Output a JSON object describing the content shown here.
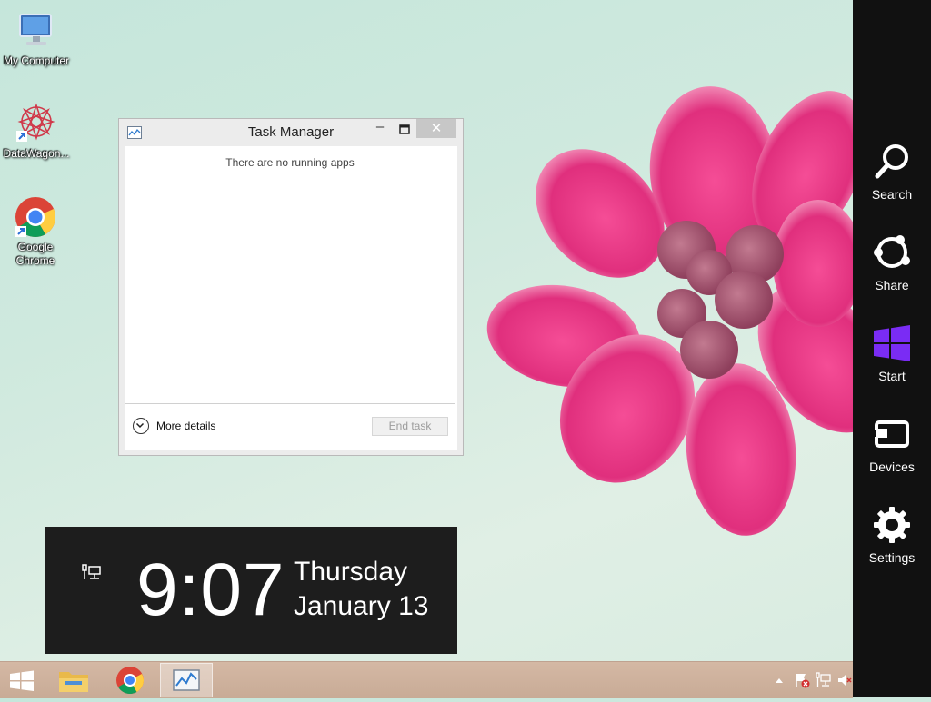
{
  "desktop": {
    "icons": [
      {
        "label": "My Computer"
      },
      {
        "label": "DataWagon..."
      },
      {
        "label": "Google Chrome"
      }
    ]
  },
  "task_manager": {
    "title": "Task Manager",
    "minimize_glyph": "–",
    "close_glyph": "✕",
    "empty_message": "There are no running apps",
    "more_details_label": "More details",
    "end_task_label": "End task"
  },
  "clock": {
    "time": "9:07",
    "day": "Thursday",
    "date": "January 13"
  },
  "charms": [
    {
      "label": "Search",
      "icon": "search-icon"
    },
    {
      "label": "Share",
      "icon": "share-icon"
    },
    {
      "label": "Start",
      "icon": "windows-logo-icon"
    },
    {
      "label": "Devices",
      "icon": "devices-icon"
    },
    {
      "label": "Settings",
      "icon": "gear-icon"
    }
  ],
  "taskbar": {
    "start_icon": "windows-logo-icon",
    "pinned": [
      "file-explorer-icon",
      "chrome-icon",
      "task-manager-icon"
    ]
  },
  "colors": {
    "charms_bg": "#111111",
    "start_charm_accent": "#7a2cf4",
    "taskbar": "#ccb09b",
    "wallpaper_flower": "#e0347a"
  }
}
